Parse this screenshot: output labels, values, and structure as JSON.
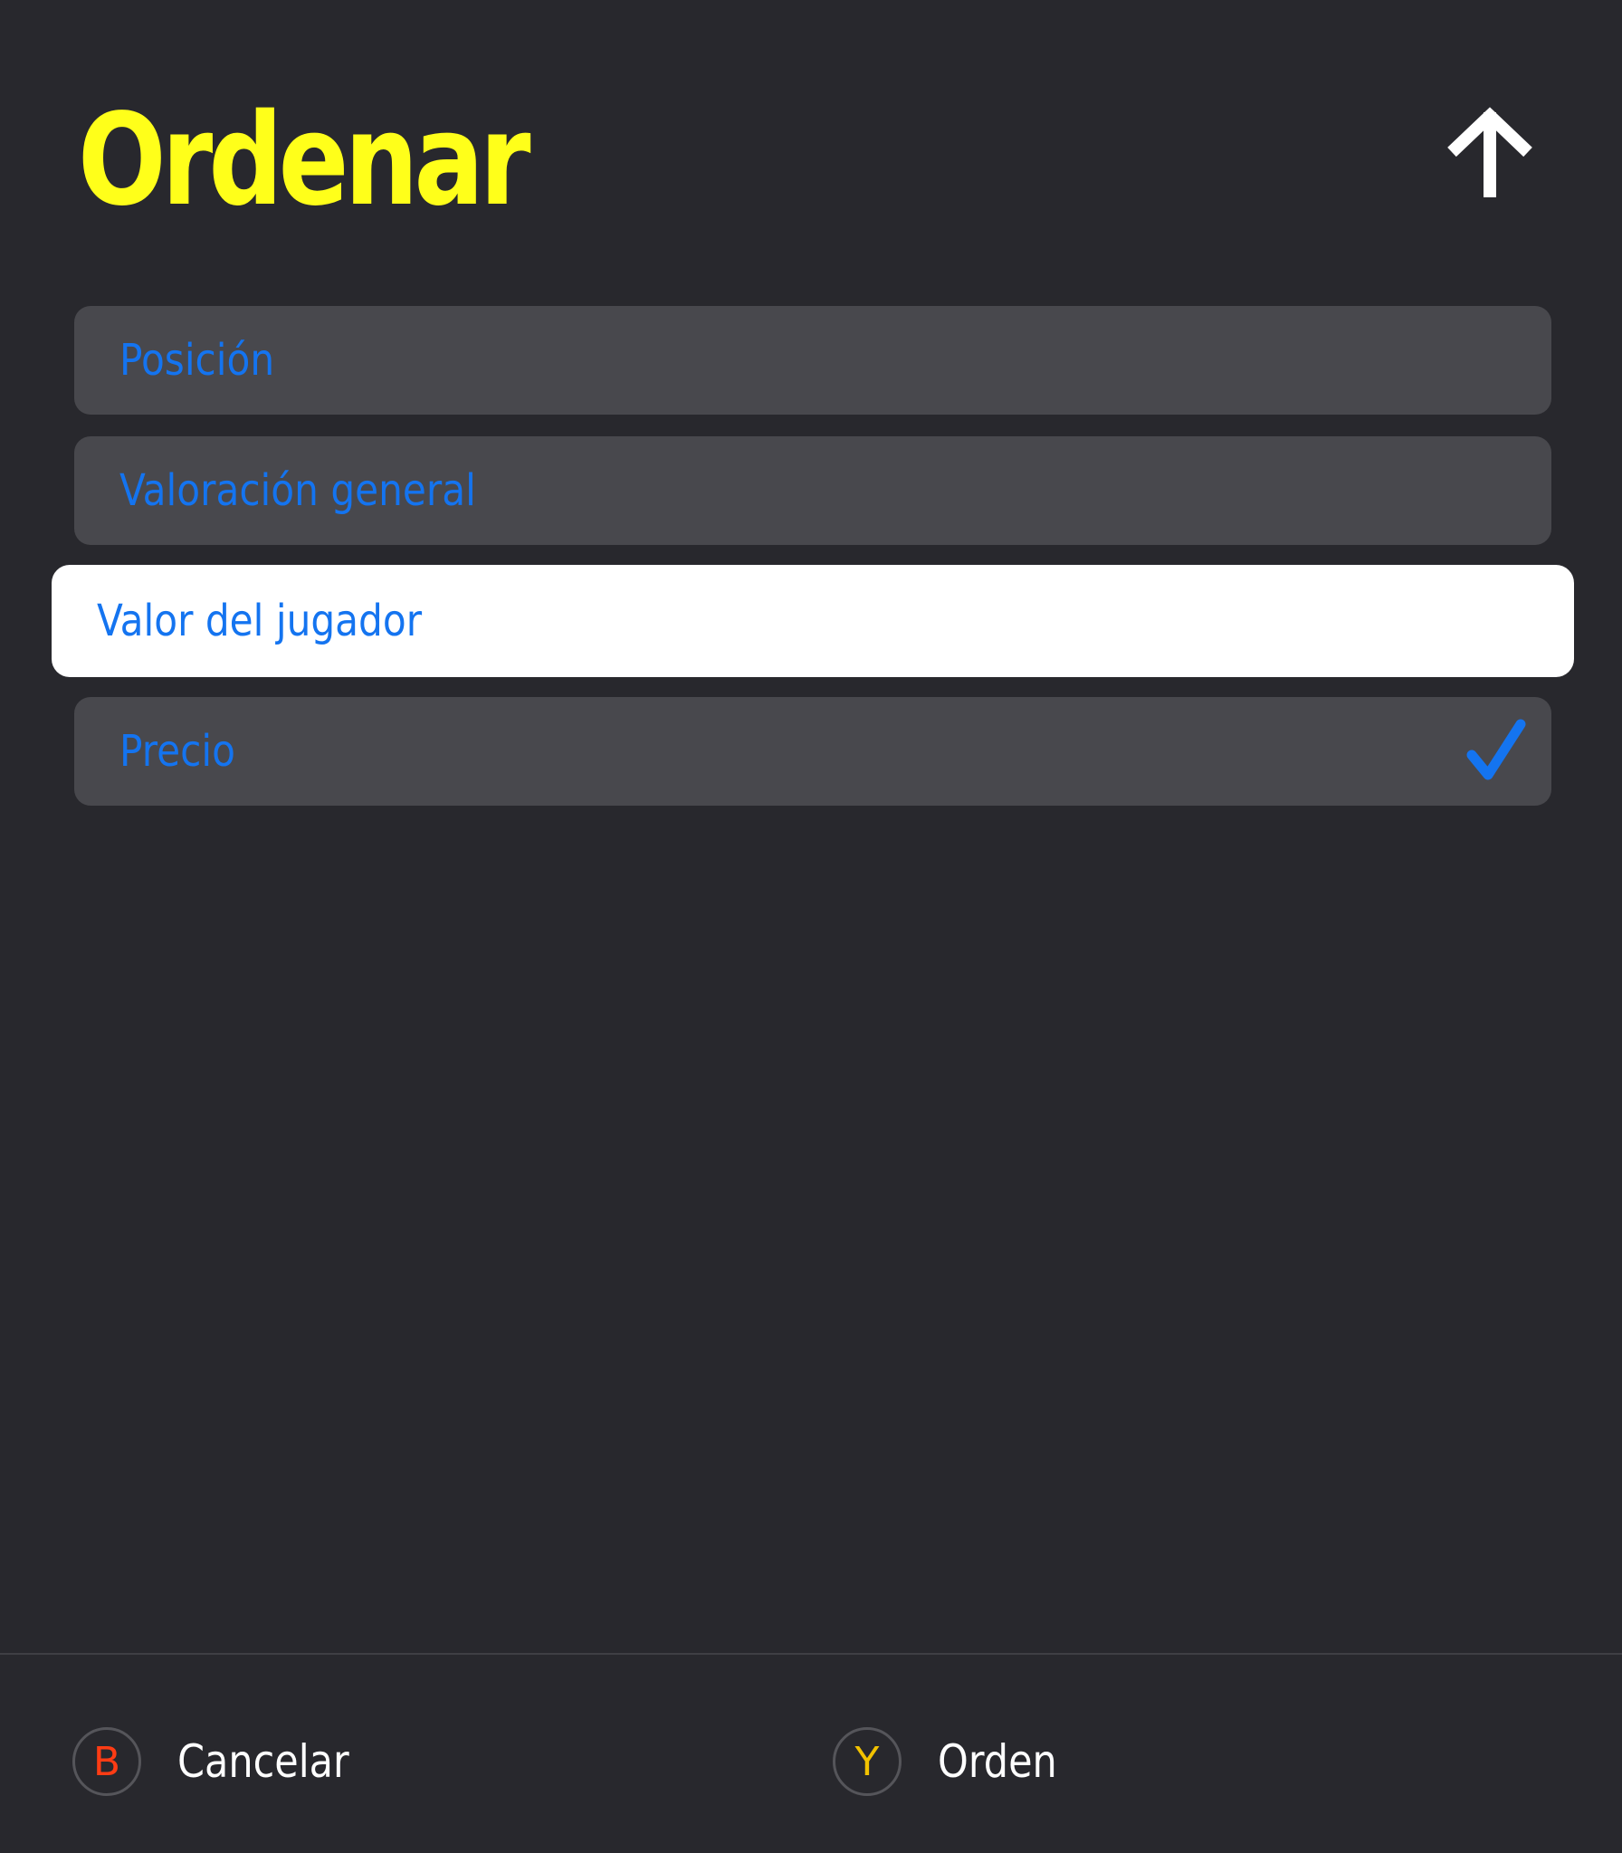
{
  "header": {
    "title": "Ordenar",
    "sort_direction_icon": "arrow-up-icon",
    "title_color": "#ffff1a"
  },
  "options": [
    {
      "label": "Posición",
      "focused": false,
      "selected": false
    },
    {
      "label": "Valoración general",
      "focused": false,
      "selected": false
    },
    {
      "label": "Valor del jugador",
      "focused": true,
      "selected": false
    },
    {
      "label": "Precio",
      "focused": false,
      "selected": true
    }
  ],
  "colors": {
    "background": "#28282d",
    "option_background": "#48484d",
    "focused_background": "#ffffff",
    "option_text": "#1474f0",
    "check": "#1474f0"
  },
  "footer": {
    "cancel": {
      "button": "B",
      "label": "Cancelar",
      "button_color": "#ff3c14"
    },
    "order": {
      "button": "Y",
      "label": "Orden",
      "button_color": "#f2c200"
    }
  }
}
